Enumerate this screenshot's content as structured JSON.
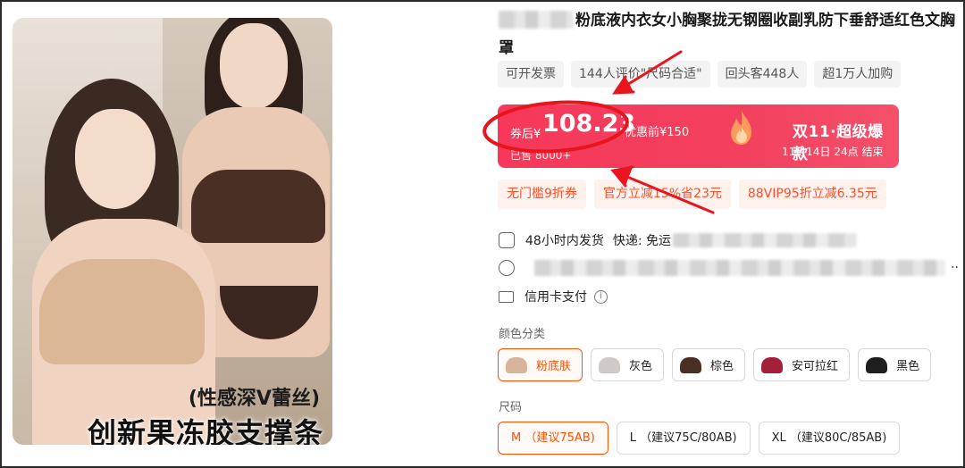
{
  "product": {
    "title": "粉底液内衣女小胸聚拢无钢圈收副乳防下垂舒适红色文胸罩",
    "tags": [
      "可开发票",
      "144人评价\"尺码合适\"",
      "回头客448人",
      "超1万人加购"
    ]
  },
  "image": {
    "caption_small": "(性感深V蕾丝)",
    "caption_large": "创新果冻胶支撑条"
  },
  "price": {
    "prefix": "券后¥",
    "value": "108.23",
    "original": "优惠前¥150",
    "sold": "已售 8000+",
    "promo_title": "双11·超级爆款",
    "promo_end": "11月14日 24点  结束"
  },
  "coupons": [
    "无门槛9折券",
    "官方立减15%省23元",
    "88VIP95折立减6.35元"
  ],
  "service": {
    "shipping_time": "48小时内发货",
    "shipping_label": "快递: 免运",
    "address_more": "··",
    "payment": "信用卡支付",
    "info_symbol": "i"
  },
  "colors": {
    "label": "颜色分类",
    "options": [
      {
        "label": "粉底肤",
        "swatch": "#d7b49a"
      },
      {
        "label": "灰色",
        "swatch": "#cfcac6"
      },
      {
        "label": "棕色",
        "swatch": "#4a2f24"
      },
      {
        "label": "安可拉红",
        "swatch": "#a3203a"
      },
      {
        "label": "黑色",
        "swatch": "#1e1e1e"
      }
    ],
    "selected": "粉底肤"
  },
  "sizes": {
    "label": "尺码",
    "options": [
      "M （建议75AB)",
      "L （建议75C/80AB)",
      "XL （建议80C/85AB)"
    ],
    "selected": "M （建议75AB)"
  },
  "theme": {
    "accent": "#ff5000",
    "price_card": "#f7385a",
    "annotation_red": "#e8141e"
  }
}
